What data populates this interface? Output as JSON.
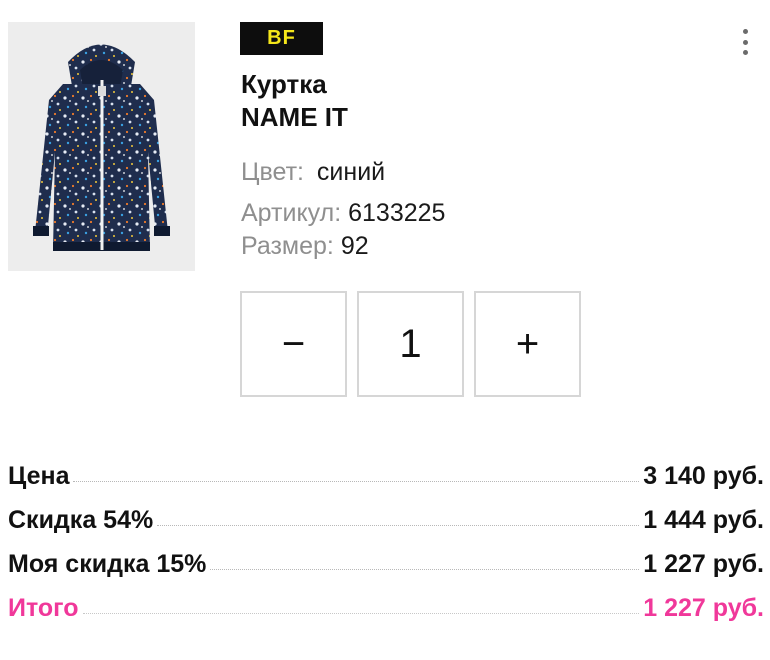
{
  "product": {
    "badge": "BF",
    "title_line1": "Куртка",
    "title_line2": "NAME IT",
    "image_icon": "jacket-image",
    "attributes": {
      "color_label": "Цвет:",
      "color_value": "синий",
      "sku_label": "Артикул:",
      "sku_value": "6133225",
      "size_label": "Размер:",
      "size_value": "92"
    }
  },
  "menu": {
    "icon": "kebab-menu-icon"
  },
  "quantity": {
    "minus_label": "−",
    "value": "1",
    "plus_label": "+"
  },
  "prices": {
    "rows": [
      {
        "label": "Цена",
        "value": "3 140 руб."
      },
      {
        "label": "Скидка 54%",
        "value": "1 444 руб."
      },
      {
        "label": "Моя скидка 15%",
        "value": "1 227 руб."
      }
    ],
    "total": {
      "label": "Итого",
      "value": "1 227 руб."
    }
  },
  "colors": {
    "badge_bg": "#0d0d0d",
    "badge_text": "#f5e61a",
    "total_accent": "#f0389a",
    "label_gray": "#8f8f8f"
  }
}
